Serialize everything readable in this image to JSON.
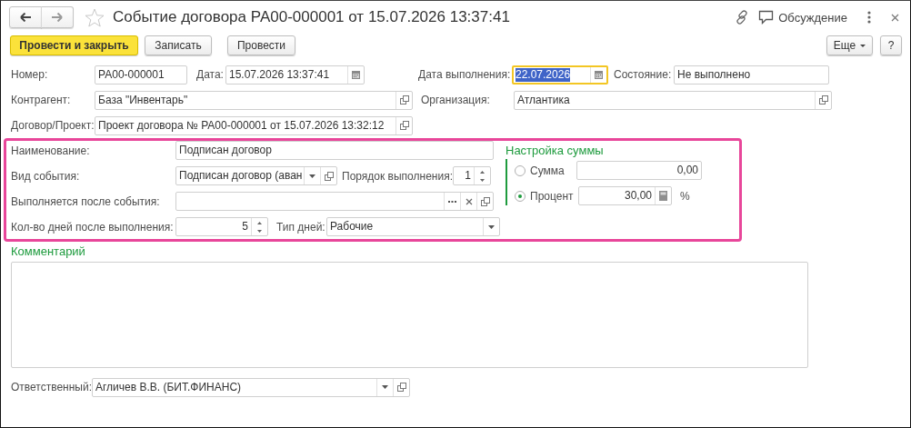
{
  "window": {
    "title": "Событие договора РА00-000001 от 15.07.2026 13:37:41",
    "favorite": false,
    "discussion": "Обсуждение"
  },
  "command_bar": {
    "buttons": [
      {
        "label": "Провести и закрыть",
        "kind": "default"
      },
      {
        "label": "Записать",
        "kind": "normal"
      },
      {
        "label": "Провести",
        "kind": "normal"
      }
    ],
    "more": "Еще",
    "help": "?"
  },
  "header_rows": [
    [
      {
        "label": "Номер:",
        "value": "РА00-000001",
        "focused": false
      },
      {
        "label": "Дата:",
        "value": "15.07.2026 13:37:41",
        "calendar_button": true,
        "focused": false
      },
      {
        "label": "Дата выполнения:",
        "value": "22.07.2026",
        "calendar_button": true,
        "focused": true
      },
      {
        "label": "Состояние:",
        "value": "Не выполнено",
        "focused": false
      }
    ],
    [
      {
        "label": "Контрагент:",
        "value": "База \"Инвентарь\"",
        "open_button": true,
        "focused": false
      },
      {
        "label": "Организация:",
        "value": "Атлантика",
        "open_button": true,
        "focused": false
      }
    ],
    [
      {
        "label": "Договор/Проект:",
        "value": "Проект договора № РА00-000001 от 15.07.2026 13:32:12",
        "open_button": true,
        "focused": false
      }
    ]
  ],
  "event_rows": [
    [
      {
        "label": "Наименование:",
        "value": "Подписан договор",
        "focused": false
      }
    ],
    [
      {
        "label": "Вид события:",
        "value": "Подписан договор (аван",
        "dropdown_button": true,
        "open_button": true,
        "focused": false
      },
      {
        "label": "Порядок выполнения:",
        "value": "1",
        "numeric": true,
        "spin_buttons": true,
        "focused": false
      }
    ],
    [
      {
        "label": "Выполняется после события:",
        "choose_button": true,
        "clear_button": true,
        "open_button": true,
        "focused": false
      }
    ],
    [
      {
        "label": "Кол-во дней  после выполнения:",
        "value": "5",
        "numeric": true,
        "spin_buttons": true,
        "focused": false
      },
      {
        "label": "Тип дней:",
        "value": "Рабочие",
        "dropdown_button": true,
        "focused": false
      }
    ]
  ],
  "amount_settings": {
    "title": "Настройка суммы",
    "options": [
      {
        "label": "Сумма",
        "selected": false,
        "value": "0,00"
      },
      {
        "label": "Процент",
        "selected": true,
        "value": "30,00",
        "calc_button": true,
        "unit": "%"
      }
    ]
  },
  "comment": {
    "label": "Комментарий"
  },
  "responsible": {
    "label": "Ответственный:",
    "value": "Агличев В.В. (БИТ.ФИНАНС)",
    "dropdown_button": true,
    "open_button": true,
    "focused": false
  }
}
